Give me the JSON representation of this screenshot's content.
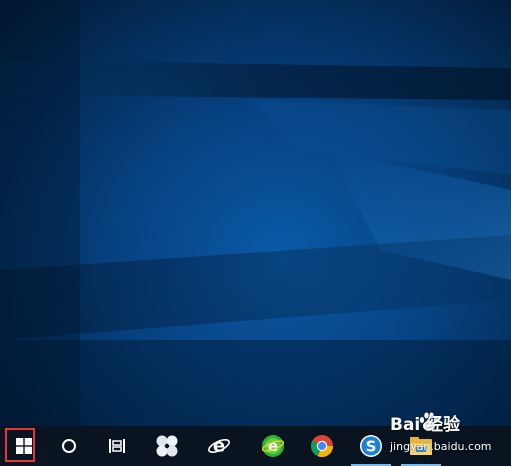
{
  "desktop": {
    "wallpaper": "windows-10-hero-blue",
    "accent_color": "#0078d7"
  },
  "taskbar": {
    "background_color": "#0a1420",
    "highlight_color": "#e0383e",
    "items": [
      {
        "name": "start-button",
        "icon": "windows-logo-icon"
      },
      {
        "name": "cortana-search-button",
        "icon": "cortana-circle-icon"
      },
      {
        "name": "task-view-button",
        "icon": "task-view-icon"
      },
      {
        "name": "pinned-app-pinwheel",
        "icon": "pinwheel-icon"
      },
      {
        "name": "internet-explorer-button",
        "icon": "internet-explorer-icon"
      },
      {
        "name": "browser-360-button",
        "icon": "360-browser-icon"
      },
      {
        "name": "chrome-button",
        "icon": "chrome-icon"
      },
      {
        "name": "sogou-browser-button",
        "icon": "sogou-browser-icon"
      },
      {
        "name": "file-explorer-button",
        "icon": "file-explorer-icon"
      }
    ]
  },
  "watermark": {
    "brand": "Bai  经验",
    "url": "jingyan.baidu.com"
  }
}
